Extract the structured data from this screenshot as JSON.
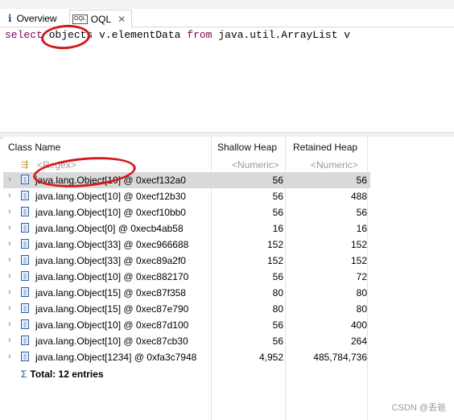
{
  "tabs": [
    {
      "label": "Overview",
      "icon": "info-icon"
    },
    {
      "label": "OQL",
      "icon": "oql-icon",
      "close": "✕"
    }
  ],
  "query": {
    "kw_select": "select",
    "sp1": " ",
    "objects": "objects",
    "mid": " v.elementData ",
    "kw_from": "from",
    "rest": " java.util.ArrayList v"
  },
  "table": {
    "columns": [
      "Class Name",
      "Shallow Heap",
      "Retained Heap"
    ],
    "filters": [
      "<Regex>",
      "<Numeric>",
      "<Numeric>"
    ],
    "rows": [
      {
        "name": "java.lang.Object[10] @ 0xecf132a0",
        "shallow": "56",
        "retained": "56"
      },
      {
        "name": "java.lang.Object[10] @ 0xecf12b30",
        "shallow": "56",
        "retained": "488"
      },
      {
        "name": "java.lang.Object[10] @ 0xecf10bb0",
        "shallow": "56",
        "retained": "56"
      },
      {
        "name": "java.lang.Object[0] @ 0xecb4ab58",
        "shallow": "16",
        "retained": "16"
      },
      {
        "name": "java.lang.Object[33] @ 0xec966688",
        "shallow": "152",
        "retained": "152"
      },
      {
        "name": "java.lang.Object[33] @ 0xec89a2f0",
        "shallow": "152",
        "retained": "152"
      },
      {
        "name": "java.lang.Object[10] @ 0xec882170",
        "shallow": "56",
        "retained": "72"
      },
      {
        "name": "java.lang.Object[15] @ 0xec87f358",
        "shallow": "80",
        "retained": "80"
      },
      {
        "name": "java.lang.Object[15] @ 0xec87e790",
        "shallow": "80",
        "retained": "80"
      },
      {
        "name": "java.lang.Object[10] @ 0xec87d100",
        "shallow": "56",
        "retained": "400"
      },
      {
        "name": "java.lang.Object[10] @ 0xec87cb30",
        "shallow": "56",
        "retained": "264"
      },
      {
        "name": "java.lang.Object[1234] @ 0xfa3c7948",
        "shallow": "4,952",
        "retained": "485,784,736"
      }
    ],
    "total": "Total: 12 entries"
  },
  "watermark": "CSDN @丢爸",
  "colors": {
    "keyword": "#7f0055",
    "annotation": "#d4191f",
    "selection": "#d9d9d9"
  }
}
